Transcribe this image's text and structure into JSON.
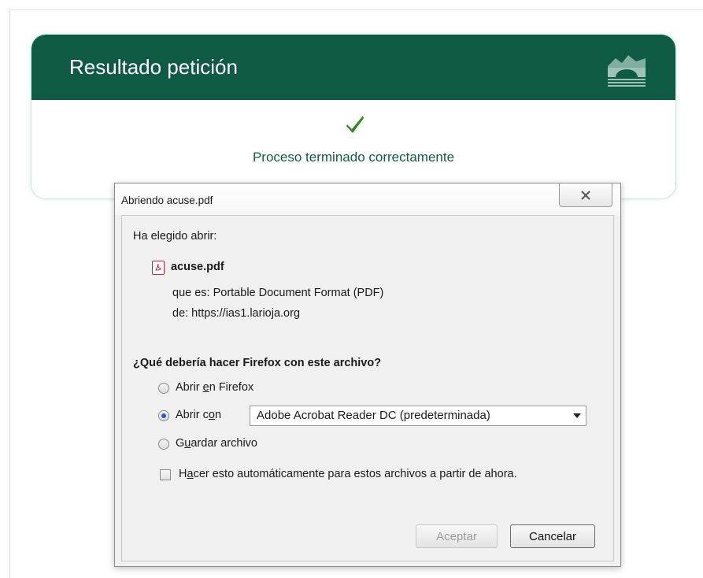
{
  "card": {
    "title": "Resultado petición",
    "message": "Proceso terminado correctamente"
  },
  "dialog": {
    "title": "Abriendo acuse.pdf",
    "intro": "Ha elegido abrir:",
    "file_name": "acuse.pdf",
    "file_type": "que es: Portable Document Format (PDF)",
    "file_source": "de: https://ias1.larioja.org",
    "question": "¿Qué debería hacer Firefox con este archivo?",
    "options": {
      "open_firefox": {
        "pre": "Abrir ",
        "ul": "e",
        "post": "n Firefox"
      },
      "open_with": {
        "pre": "Abrir c",
        "ul": "o",
        "post": "n"
      },
      "save": {
        "pre": "G",
        "ul": "u",
        "post": "ardar archivo"
      }
    },
    "app_select": "Adobe Acrobat Reader DC  (predeterminada)",
    "auto_checkbox": {
      "pre": "H",
      "ul": "a",
      "post": "cer esto automáticamente para estos archivos a partir de ahora."
    },
    "accept_label": "Aceptar",
    "cancel_label": "Cancelar",
    "selected_option": "open_with"
  },
  "colors": {
    "header_green": "#0f5a45",
    "message_green": "#145a44",
    "check_green": "#2e8b1e"
  }
}
